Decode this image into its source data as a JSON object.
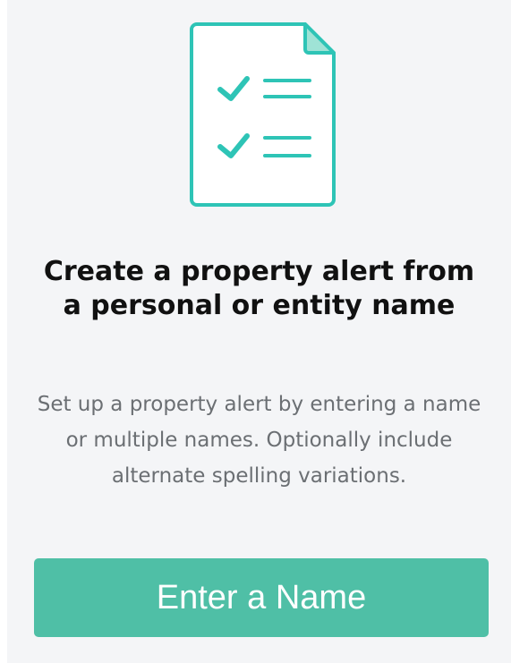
{
  "card": {
    "icon": "checklist-document-icon",
    "title": "Create a property alert from a personal or entity name",
    "description": "Set up a property alert by entering a name or multiple names. Optionally include alternate spelling variations.",
    "button_label": "Enter a Name"
  },
  "colors": {
    "accent": "#2ec4b6",
    "button": "#4fbfa6",
    "card_background": "#f4f5f7",
    "title_text": "#111111",
    "body_text": "#6b6f73"
  }
}
